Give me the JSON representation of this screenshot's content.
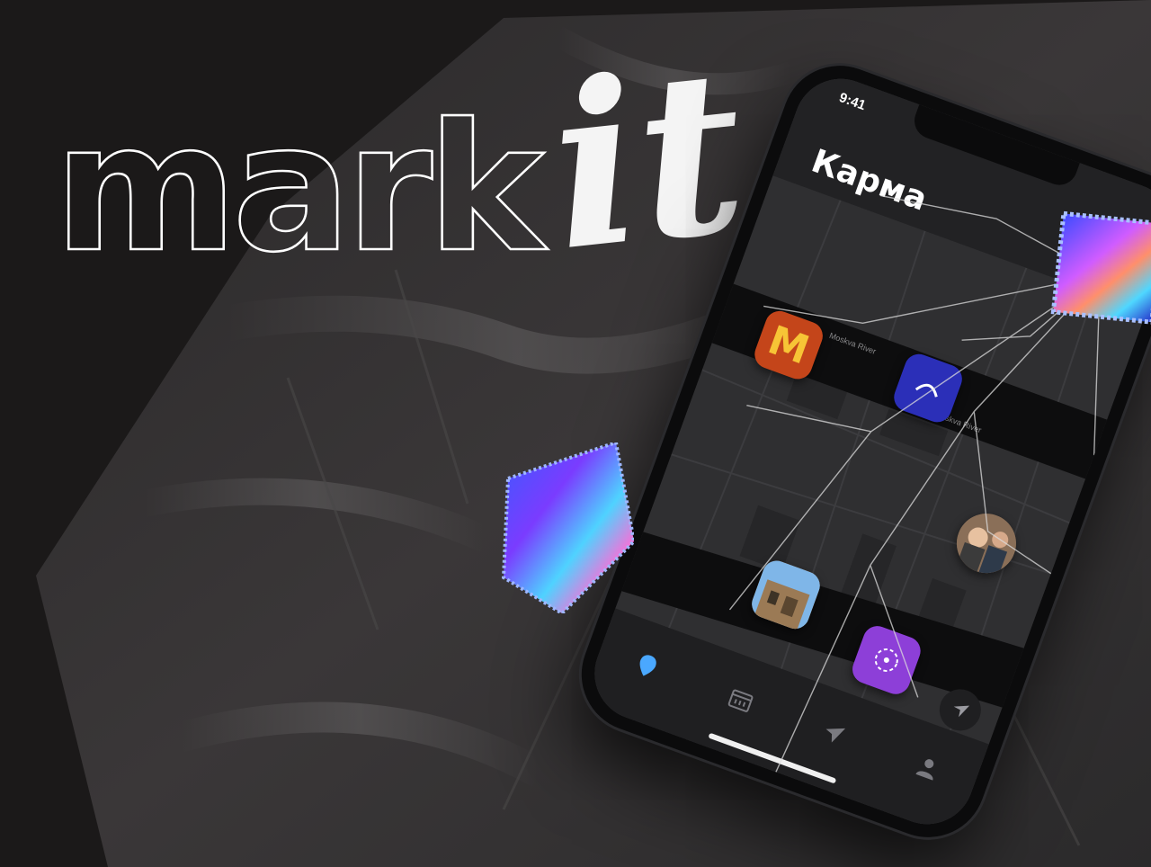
{
  "colors": {
    "background": "#1b1919",
    "accent_blue": "#2b2fb8",
    "accent_purple": "#8d3fd8",
    "mcdonalds_red": "#c4451a",
    "mcdonalds_yellow": "#f7c436"
  },
  "title": {
    "mark": "mark",
    "it": "it"
  },
  "phone": {
    "status_time": "9:41",
    "app_title": "Карма",
    "map_labels": [
      "Moskva River",
      "Moskva River"
    ],
    "pins": [
      {
        "name": "mcdonalds",
        "glyph": "M"
      },
      {
        "name": "brand-logo"
      },
      {
        "name": "people-photo"
      },
      {
        "name": "building-photo"
      },
      {
        "name": "circle-dots"
      }
    ],
    "tabs": [
      "map-pin-icon",
      "calendar-icon",
      "send-icon",
      "profile-icon"
    ],
    "locate_icon": "navigation-arrow-icon"
  }
}
